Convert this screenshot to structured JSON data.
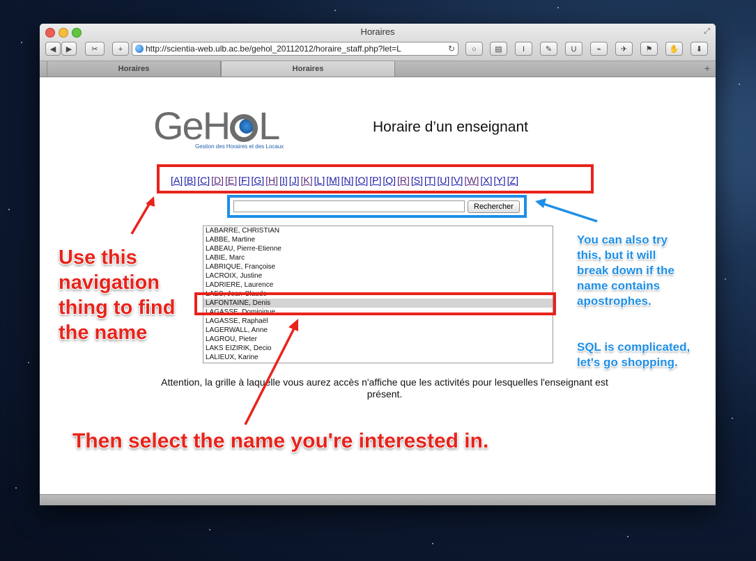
{
  "window": {
    "title": "Horaires"
  },
  "toolbar": {
    "back_label": "◀",
    "forward_label": "▶",
    "add_label": "+",
    "url": "http://scientia-web.ulb.ac.be/gehol_20112012/horaire_staff.php?let=L"
  },
  "tabs": [
    {
      "label": "Horaires"
    },
    {
      "label": "Horaires"
    }
  ],
  "logo": {
    "name": "GeHOL",
    "subtitle": "Gestion des Horaires et des Locaux"
  },
  "page": {
    "heading": "Horaire d’un enseignant",
    "letters": [
      "[A]",
      "[B]",
      "[C]",
      "[D]",
      "[E]",
      "[F]",
      "[G]",
      "[H]",
      "[I]",
      "[J]",
      "[K]",
      "[L]",
      "[M]",
      "[N]",
      "[O]",
      "[P]",
      "[Q]",
      "[R]",
      "[S]",
      "[T]",
      "[U]",
      "[V]",
      "[W]",
      "[X]",
      "[Y]",
      "[Z]"
    ],
    "search": {
      "value": "",
      "button_label": "Rechercher"
    },
    "names": [
      "LABARRE, CHRISTIAN",
      "LABBE, Martine",
      "LABEAU, Pierre-Etienne",
      "LABIE, Marc",
      "LABRIQUE, Françoise",
      "LACROIX, Justine",
      "LADRIERE, Laurence",
      "LAES, Jean-Claude",
      "LAFONTAINE, Denis",
      "LAGASSE, Dominique",
      "LAGASSE, Raphaël",
      "LAGERWALL, Anne",
      "LAGROU, Pieter",
      "LAKS EIZIRIK, Decio",
      "LALIEUX, Karine"
    ],
    "selected_name": "LAFONTAINE, Denis",
    "note": "Attention, la grille à laquelle vous aurez accès n'affiche que les activités pour lesquelles l'enseignant est présent."
  },
  "annotations": {
    "nav": "Use this navigation thing to find the name",
    "select": "Then select the name you're interested in.",
    "search": "You can also try this, but it will break down if the name contains apostrophes.",
    "sql": "SQL is complicated, let's go shopping.",
    "red_color": "#e8231b",
    "blue_color": "#1e8fe6"
  }
}
